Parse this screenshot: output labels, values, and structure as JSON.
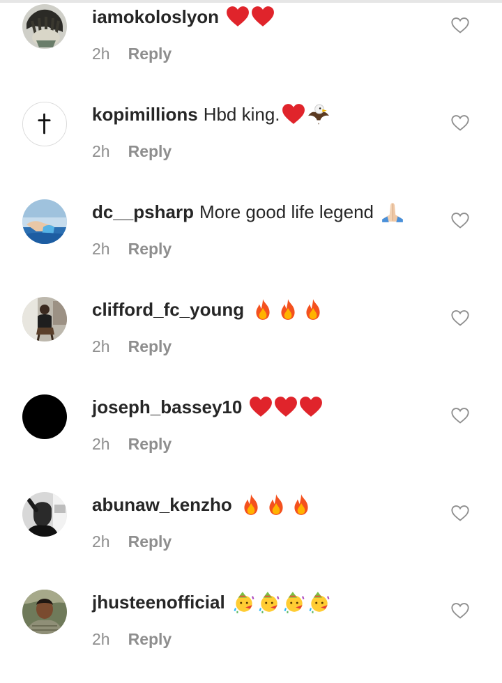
{
  "colors": {
    "text": "#262626",
    "muted": "#8e8e8e",
    "heart_red": "#e0242b",
    "background": "#ffffff"
  },
  "comments": [
    {
      "username": "iamokoloslyon",
      "text": "",
      "emojis": [
        "heart",
        "heart"
      ],
      "time": "2h",
      "reply_label": "Reply",
      "avatar": "photo-dreadlocks"
    },
    {
      "username": "kopimillions",
      "text": "Hbd king.",
      "emojis": [
        "heart",
        "eagle"
      ],
      "time": "2h",
      "reply_label": "Reply",
      "avatar": "cross-symbol"
    },
    {
      "username": "dc__psharp",
      "text": "More good life legend",
      "emojis": [
        "folded-hands"
      ],
      "time": "2h",
      "reply_label": "Reply",
      "avatar": "photo-pool"
    },
    {
      "username": "clifford_fc_young",
      "text": "",
      "emojis": [
        "fire",
        "fire",
        "fire"
      ],
      "time": "2h",
      "reply_label": "Reply",
      "avatar": "photo-chair"
    },
    {
      "username": "joseph_bassey10",
      "text": "",
      "emojis": [
        "heart",
        "heart",
        "heart"
      ],
      "time": "2h",
      "reply_label": "Reply",
      "avatar": "black-circle"
    },
    {
      "username": "abunaw_kenzho",
      "text": "",
      "emojis": [
        "fire",
        "fire",
        "fire"
      ],
      "time": "2h",
      "reply_label": "Reply",
      "avatar": "photo-bw"
    },
    {
      "username": "jhusteenofficial",
      "text": "",
      "emojis": [
        "party-face",
        "party-face",
        "party-face",
        "party-face"
      ],
      "time": "2h",
      "reply_label": "Reply",
      "avatar": "photo-portrait"
    }
  ]
}
